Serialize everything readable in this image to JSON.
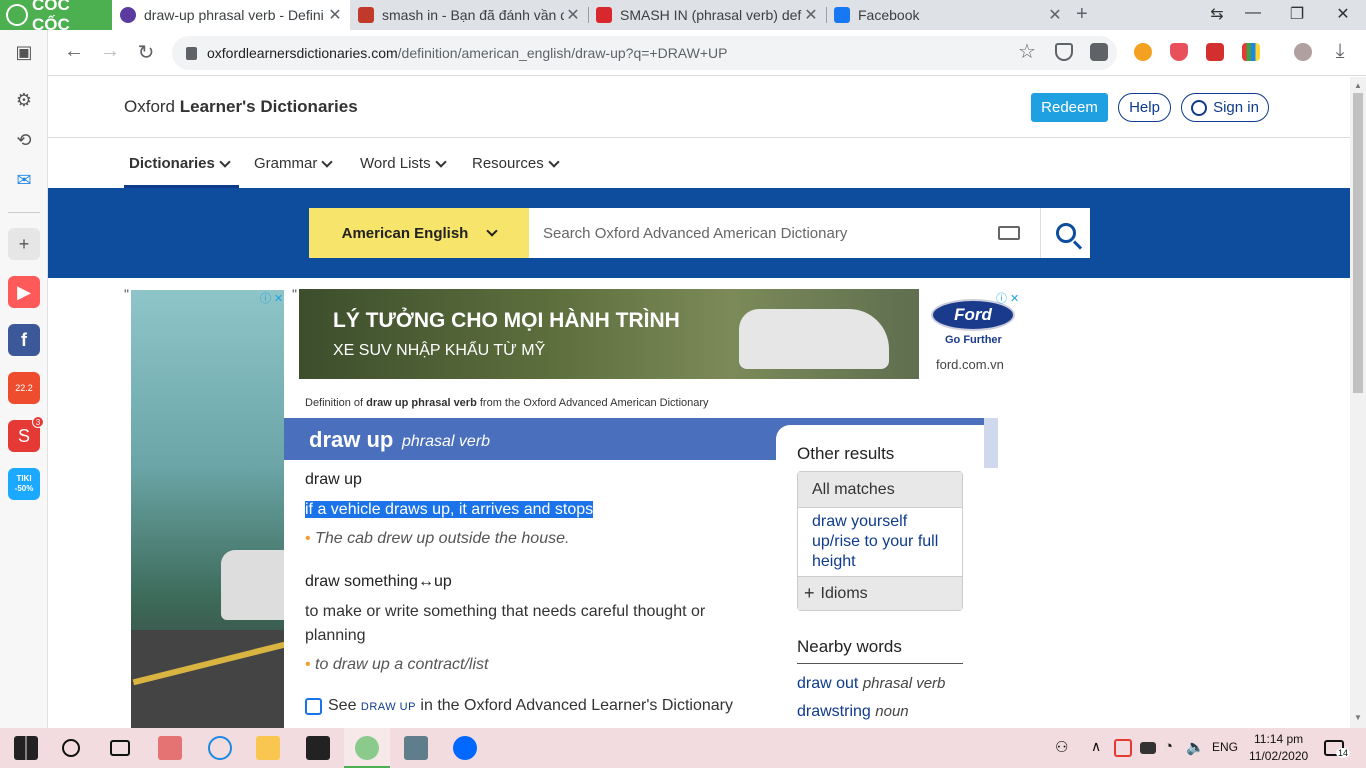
{
  "browser": {
    "brand": "CỐC CỐC",
    "tabs": [
      {
        "title": "draw-up phrasal verb - Defini",
        "fav_color": "#5b3c9e"
      },
      {
        "title": "smash in - Bạn đã đánh vần đ",
        "fav_color": "#c0392b"
      },
      {
        "title": "SMASH IN (phrasal verb) defi",
        "fav_color": "#d9272e"
      },
      {
        "title": "Facebook",
        "fav_color": "#1877f2"
      }
    ],
    "url_domain": "oxfordlearnersdictionaries.com",
    "url_path": "/definition/american_english/draw-up?q=+DRAW+UP"
  },
  "header": {
    "site_title_plain": "Oxford ",
    "site_title_bold": "Learner's Dictionaries",
    "redeem": "Redeem",
    "help": "Help",
    "signin": "Sign in"
  },
  "menu": [
    "Dictionaries",
    "Grammar",
    "Word Lists",
    "Resources"
  ],
  "search": {
    "dictionary": "American English",
    "placeholder": "Search Oxford Advanced American Dictionary"
  },
  "ads": {
    "line1": "LÝ TƯỞNG CHO MỌI HÀNH TRÌNH",
    "line2": "XE SUV NHẬP KHẨU TỪ MỸ",
    "brand": "Ford",
    "tagline": "Go Further",
    "url": "ford.com.vn",
    "quote": "\""
  },
  "entry": {
    "source_pre": "Definition of ",
    "source_bold": "draw up phrasal verb",
    "source_post": " from the Oxford Advanced American Dictionary",
    "headword": "draw up",
    "pos": "phrasal verb",
    "senses": [
      {
        "title": "draw up",
        "definition": "if a vehicle draws up, it arrives and stops",
        "example": "The cab drew up outside the house."
      },
      {
        "title": "draw something↔up",
        "definition": "to make or write something that needs careful thought or planning",
        "example": "to draw up a contract/list"
      }
    ],
    "see_pre": "See ",
    "see_sc": "DRAW UP",
    "see_post": " in the Oxford Advanced Learner's Dictionary"
  },
  "sidebar": {
    "other_results": "Other results",
    "all_matches": "All matches",
    "match_link": "draw yourself up/rise to your full height",
    "idioms": "Idioms",
    "nearby_title": "Nearby words",
    "nearby": [
      {
        "word": "draw out",
        "pos": "phrasal verb"
      },
      {
        "word": "drawstring",
        "pos": "noun"
      }
    ]
  },
  "taskbar": {
    "lang": "ENG",
    "time": "11:14 pm",
    "date": "11/02/2020",
    "notifications": "14"
  },
  "sidebar_badges": {
    "shopee": "22.2",
    "sendo": "3",
    "tiki": "TIKI -50%"
  }
}
